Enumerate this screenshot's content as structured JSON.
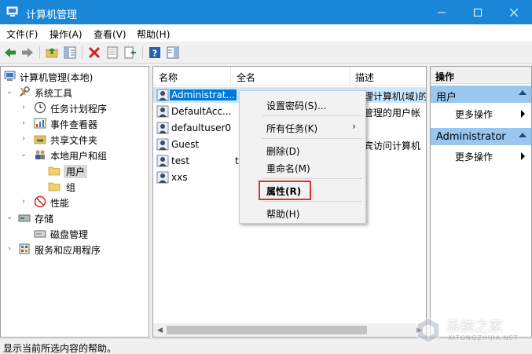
{
  "window": {
    "title": "计算机管理",
    "accent": "#1a86d8",
    "controls": [
      "minimize-icon",
      "maximize-icon",
      "close-icon"
    ]
  },
  "menu": [
    "文件(F)",
    "操作(A)",
    "查看(V)",
    "帮助(H)"
  ],
  "toolbar": {
    "icons": [
      "back-arrow-icon",
      "forward-arrow-icon",
      "up-folder-icon",
      "show-hide-tree-icon",
      "delete-icon",
      "properties-icon",
      "export-list-icon",
      "help-icon",
      "show-hide-action-pane-icon"
    ]
  },
  "tree": {
    "items": [
      {
        "label": "计算机管理(本地)",
        "icon": "computer-management-icon",
        "arrow": ""
      },
      {
        "label": "系统工具",
        "icon": "tools-icon",
        "arrow": "expanded"
      },
      {
        "label": "任务计划程序",
        "icon": "clock-icon",
        "arrow": "collapsed"
      },
      {
        "label": "事件查看器",
        "icon": "event-viewer-icon",
        "arrow": "collapsed"
      },
      {
        "label": "共享文件夹",
        "icon": "shared-folder-icon",
        "arrow": "collapsed"
      },
      {
        "label": "本地用户和组",
        "icon": "users-group-icon",
        "arrow": "expanded"
      },
      {
        "label": "用户",
        "icon": "folder-icon",
        "arrow": ""
      },
      {
        "label": "组",
        "icon": "folder-icon",
        "arrow": ""
      },
      {
        "label": "性能",
        "icon": "performance-icon",
        "arrow": "collapsed"
      },
      {
        "label": "存储",
        "icon": "storage-icon",
        "arrow": "expanded"
      },
      {
        "label": "磁盘管理",
        "icon": "disk-management-icon",
        "arrow": ""
      },
      {
        "label": "服务和应用程序",
        "icon": "services-icon",
        "arrow": "collapsed"
      }
    ]
  },
  "list": {
    "columns": [
      "名称",
      "全名",
      "描述"
    ],
    "rows": [
      {
        "name": "Administrat...",
        "fullname": "",
        "desc": "管理计算机(域)的"
      },
      {
        "name": "DefaultAcc...",
        "fullname": "",
        "desc": "统管理的用户帐"
      },
      {
        "name": "defaultuser0",
        "fullname": "",
        "desc": ""
      },
      {
        "name": "Guest",
        "fullname": "",
        "desc": "来宾访问计算机"
      },
      {
        "name": "test",
        "fullname": "t",
        "desc": ""
      },
      {
        "name": "xxs",
        "fullname": "",
        "desc": ""
      }
    ]
  },
  "context_menu": {
    "items": [
      "设置密码(S)...",
      "所有任务(K)",
      "删除(D)",
      "重命名(M)",
      "属性(R)",
      "帮助(H)"
    ],
    "submenu_glyph": "›"
  },
  "actions": {
    "title": "操作",
    "sections": [
      {
        "label": "用户",
        "item": "更多操作"
      },
      {
        "label": "Administrator",
        "item": "更多操作"
      }
    ]
  },
  "status": "显示当前所选内容的帮助。",
  "watermark": {
    "text": "系统之家",
    "sub": "XITONGZHIJIA.NET"
  }
}
